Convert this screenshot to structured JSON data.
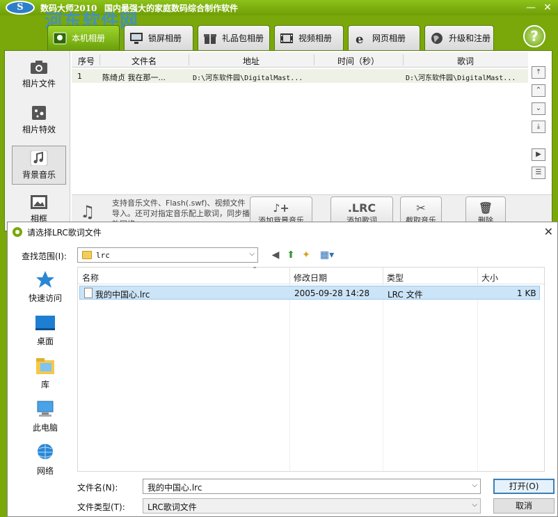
{
  "app": {
    "logo_text": "S",
    "title": "数码大师2010",
    "tagline": "国内最强大的家庭数码综合制作软件",
    "watermark": "河东软件网",
    "watermark_url": "pc0359.cn"
  },
  "tabs": [
    {
      "label": "本机相册",
      "icon": "local-album-icon"
    },
    {
      "label": "锁屏相册",
      "icon": "monitor-icon"
    },
    {
      "label": "礼品包相册",
      "icon": "gift-icon"
    },
    {
      "label": "视频相册",
      "icon": "film-icon"
    },
    {
      "label": "网页相册",
      "icon": "ie-icon"
    },
    {
      "label": "升级和注册",
      "icon": "globe-icon"
    }
  ],
  "sidebar": {
    "items": [
      {
        "label": "相片文件",
        "icon": "camera-icon"
      },
      {
        "label": "相片特效",
        "icon": "effects-icon"
      },
      {
        "label": "背景音乐",
        "icon": "music-note-icon"
      },
      {
        "label": "相框",
        "icon": "frame-icon"
      }
    ]
  },
  "table": {
    "headers": [
      "序号",
      "文件名",
      "地址",
      "时间（秒）",
      "歌词"
    ],
    "rows": [
      {
        "index": "1",
        "filename": "陈绮贞 我在那一...",
        "path": "D:\\河东软件园\\DigitalMast...",
        "time": "",
        "lyrics": "D:\\河东软件园\\DigitalMast..."
      }
    ]
  },
  "toolbar": {
    "support_text": "支持音乐文件、Flash(.swf)、视频文件导入。还可对指定音乐配上歌词，同步播放网络",
    "buttons": [
      {
        "label": "添加背景音乐",
        "glyph": "♪+"
      },
      {
        "label": "添加歌词",
        "glyph": ".LRC"
      },
      {
        "label": "截取音乐",
        "glyph": "✂"
      },
      {
        "label": "删除",
        "glyph": "🗑"
      }
    ]
  },
  "dialog": {
    "title": "请选择LRC歌词文件",
    "lookin_label": "查找范围(I):",
    "lookin_value": "lrc",
    "places": [
      {
        "label": "快速访问",
        "icon": "star-icon"
      },
      {
        "label": "桌面",
        "icon": "desktop-icon"
      },
      {
        "label": "库",
        "icon": "library-icon"
      },
      {
        "label": "此电脑",
        "icon": "computer-icon"
      },
      {
        "label": "网络",
        "icon": "network-icon"
      }
    ],
    "columns": [
      "名称",
      "修改日期",
      "类型",
      "大小"
    ],
    "files": [
      {
        "name": "我的中国心.lrc",
        "modified": "2005-09-28 14:28",
        "type": "LRC 文件",
        "size": "1 KB"
      }
    ],
    "filename_label": "文件名(N):",
    "filename_value": "我的中国心.lrc",
    "filetype_label": "文件类型(T):",
    "filetype_value": "LRC歌词文件",
    "open_label": "打开(O)",
    "cancel_label": "取消"
  }
}
